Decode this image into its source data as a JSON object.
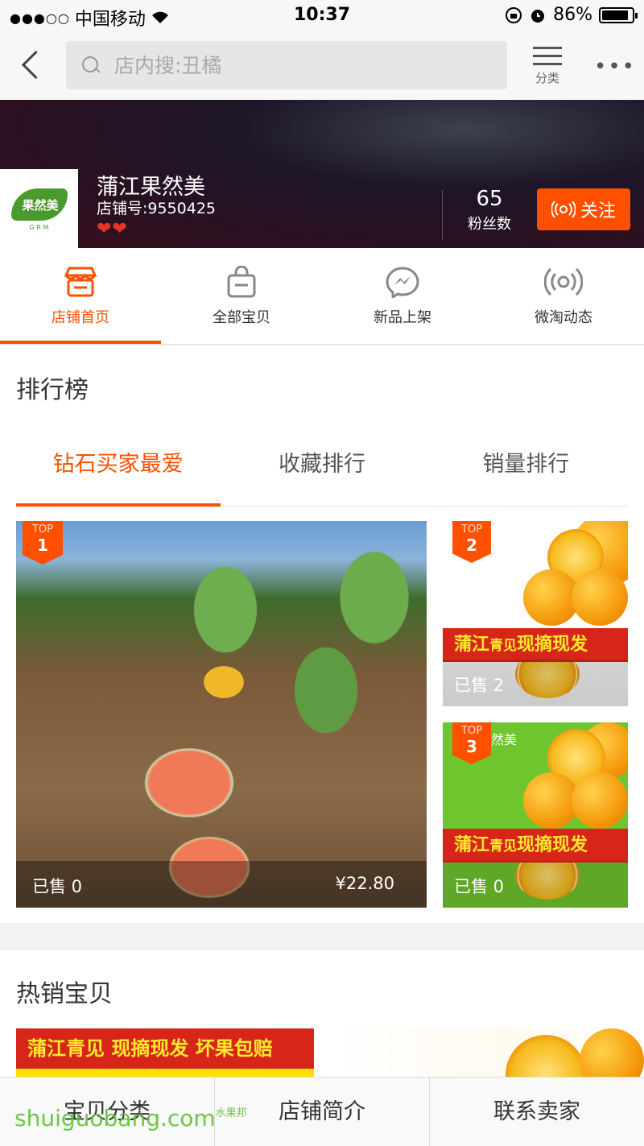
{
  "status_bar": {
    "carrier": "中国移动",
    "time": "10:37",
    "battery": "86%"
  },
  "nav": {
    "search_placeholder": "店内搜:丑橘",
    "category_label": "分类",
    "more_label": "•••"
  },
  "shop": {
    "name": "蒲江果然美",
    "shop_id": "店铺号:9550425",
    "hearts": "❤❤",
    "fans_count": "65",
    "fans_label": "粉丝数",
    "follow_label": "关注",
    "logo_text": "果然美",
    "logo_sub": "G R M"
  },
  "tabs": [
    {
      "label": "店铺首页",
      "icon": "store-icon",
      "active": true
    },
    {
      "label": "全部宝贝",
      "icon": "bag-icon",
      "active": false
    },
    {
      "label": "新品上架",
      "icon": "messenger-icon",
      "active": false
    },
    {
      "label": "微淘动态",
      "icon": "broadcast-icon",
      "active": false
    }
  ],
  "ranking": {
    "title": "排行榜",
    "tabs": [
      "钻石买家最爱",
      "收藏排行",
      "销量排行"
    ],
    "items": [
      {
        "badge_top": "TOP",
        "rank": "1",
        "sold": "已售 0",
        "price": "¥22.80"
      },
      {
        "badge_top": "TOP",
        "rank": "2",
        "sold": "已售 2",
        "banner_big": "蒲江",
        "banner_small": "青见",
        "banner_big2": "现摘现发"
      },
      {
        "badge_top": "TOP",
        "rank": "3",
        "sold": "已售 0",
        "banner_big": "蒲江",
        "banner_small": "青见",
        "banner_big2": "现摘现发",
        "brand": "然美"
      }
    ]
  },
  "hot": {
    "title": "热销宝贝",
    "banner": "蒲江青见 现摘现发 坏果包赔"
  },
  "bottom_bar": [
    "宝贝分类",
    "店铺简介",
    "联系卖家"
  ],
  "watermark": {
    "text": "shuiguobang.com",
    "small": "水果邦"
  },
  "colors": {
    "accent": "#ff5000",
    "banner_red": "#d7251a",
    "banner_yellow": "#ffea2a"
  }
}
